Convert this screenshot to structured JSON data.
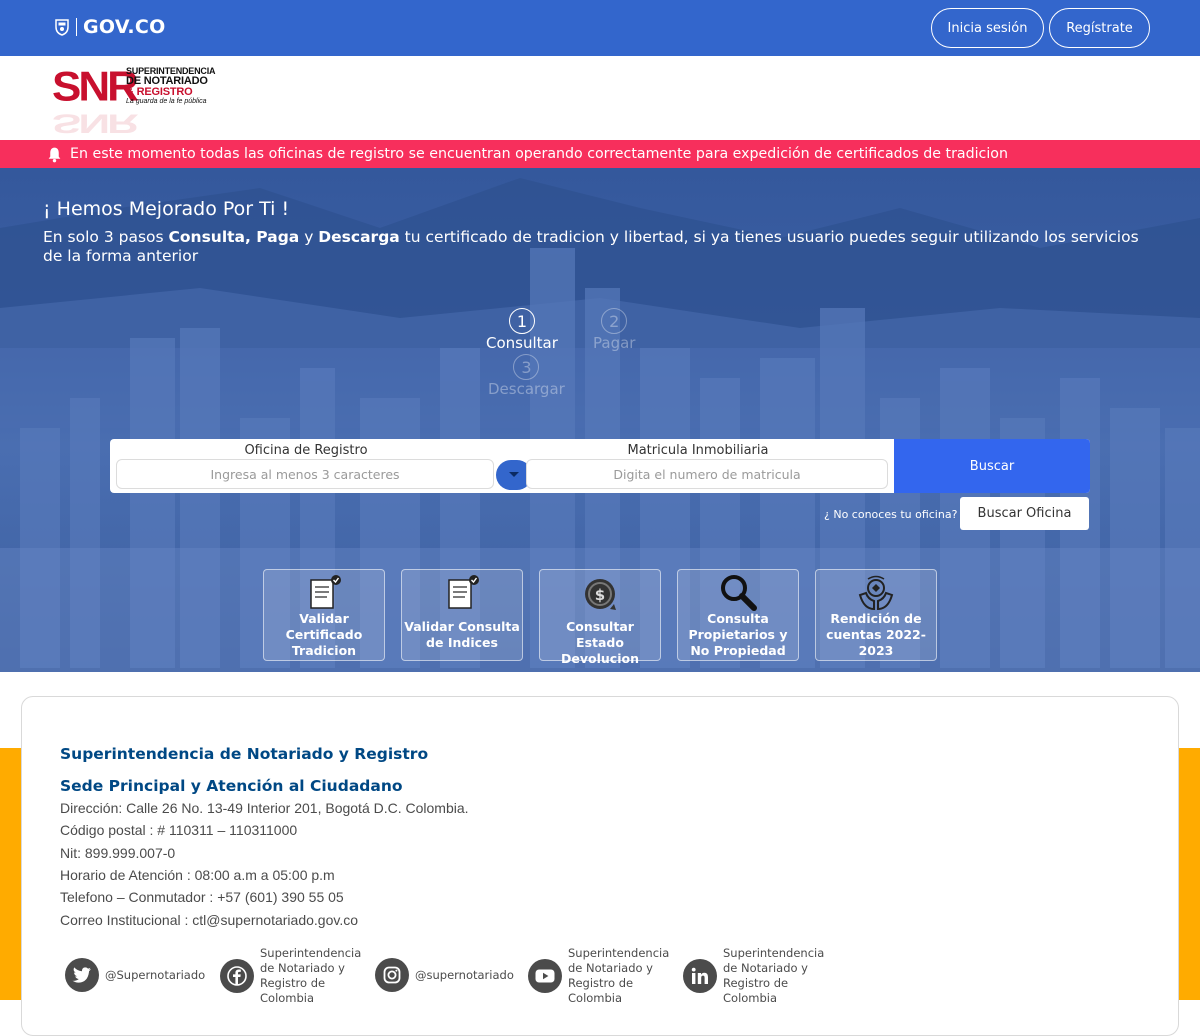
{
  "gov_bar": {
    "logo_text": "GOV.CO",
    "login_label": "Inicia sesión",
    "register_label": "Regístrate"
  },
  "snr_logo": {
    "letters": "SNR",
    "line1": "SUPERINTENDENCIA",
    "line2": "DE NOTARIADO",
    "line3": "& REGISTRO",
    "tagline": "La guarda de la fe pública"
  },
  "alert": {
    "text": "En este momento todas las oficinas de registro se encuentran operando correctamente para expedición de certificados de tradicion"
  },
  "hero": {
    "title": "¡ Hemos Mejorado Por Ti !",
    "sub_1": "En solo 3 pasos ",
    "sub_b1": "Consulta, Paga",
    "sub_2": " y ",
    "sub_b2": "Descarga",
    "sub_3": " tu certificado de tradicion y libertad, si ya tienes usuario puedes seguir utilizando los servicios de la forma anterior"
  },
  "steps": [
    {
      "num": "1",
      "label": "Consultar",
      "active": true
    },
    {
      "num": "2",
      "label": "Pagar",
      "active": false
    },
    {
      "num": "3",
      "label": "Descargar",
      "active": false
    }
  ],
  "search": {
    "office_label": "Oficina de Registro",
    "office_placeholder": "Ingresa al menos 3 caracteres",
    "matricula_label": "Matricula Inmobiliaria",
    "matricula_placeholder": "Digita el numero de matricula",
    "button_label": "Buscar",
    "unknown_office": "¿ No conoces tu oficina?",
    "find_office_label": "Buscar Oficina"
  },
  "cards": [
    {
      "icon": "certificate-check-icon",
      "label": "Validar Certificado Tradicion"
    },
    {
      "icon": "certificate-check-icon",
      "label": "Validar Consulta de Indices"
    },
    {
      "icon": "money-refund-icon",
      "label": "Consultar Estado Devolucion"
    },
    {
      "icon": "magnifier-icon",
      "label": "Consulta Propietarios y No Propiedad"
    },
    {
      "icon": "hands-accountability-icon",
      "label": "Rendición de cuentas 2022-2023"
    }
  ],
  "footer": {
    "title": "Superintendencia de Notariado y Registro",
    "subtitle": "Sede Principal y Atención al Ciudadano",
    "lines": [
      "Dirección: Calle 26 No. 13-49 Interior 201, Bogotá D.C. Colombia.",
      "Código postal : # 110311 – 110311000",
      "Nit: 899.999.007-0",
      "Horario de Atención : 08:00 a.m a 05:00 p.m",
      "Telefono – Conmutador : +57 (601) 390 55 05",
      "Correo Institucional : ctl@supernotariado.gov.co"
    ],
    "social": [
      {
        "icon": "twitter-icon",
        "text": "@Supernotariado"
      },
      {
        "icon": "facebook-icon",
        "text": "Superintendencia de Notariado y Registro de Colombia"
      },
      {
        "icon": "instagram-icon",
        "text": "@supernotariado"
      },
      {
        "icon": "youtube-icon",
        "text": "Superintendencia de Notariado y Registro de Colombia"
      },
      {
        "icon": "linkedin-icon",
        "text": "Superintendencia de Notariado y Registro de Colombia"
      }
    ]
  },
  "colors": {
    "gov_blue": "#3366cc",
    "alert_pink": "#f72f5c",
    "search_button": "#3366ee",
    "footer_band": "#ffab00",
    "footer_title": "#004884"
  }
}
